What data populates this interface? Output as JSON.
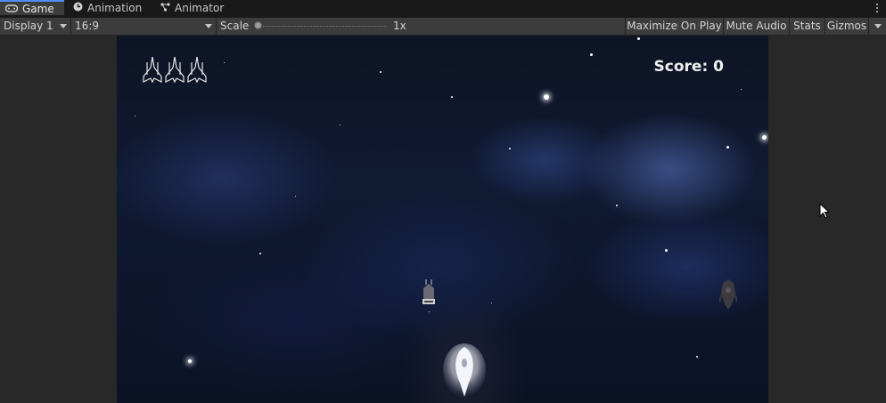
{
  "tabs": [
    {
      "label": "Game",
      "icon": "gamepad-icon",
      "active": true
    },
    {
      "label": "Animation",
      "icon": "clock-icon",
      "active": false
    },
    {
      "label": "Animator",
      "icon": "animator-icon",
      "active": false
    }
  ],
  "toolbar": {
    "display": "Display 1",
    "aspect": "16:9",
    "scale_label": "Scale",
    "scale_value": "1x",
    "maximize_on_play": "Maximize On Play",
    "mute_audio": "Mute Audio",
    "stats": "Stats",
    "gizmos": "Gizmos"
  },
  "game": {
    "score_text": "Score: 0",
    "lives": 3
  },
  "colors": {
    "active_tab_accent": "#4d8cf5",
    "panel_bg": "#282828",
    "toolbar_bg": "#3c3c3c"
  }
}
